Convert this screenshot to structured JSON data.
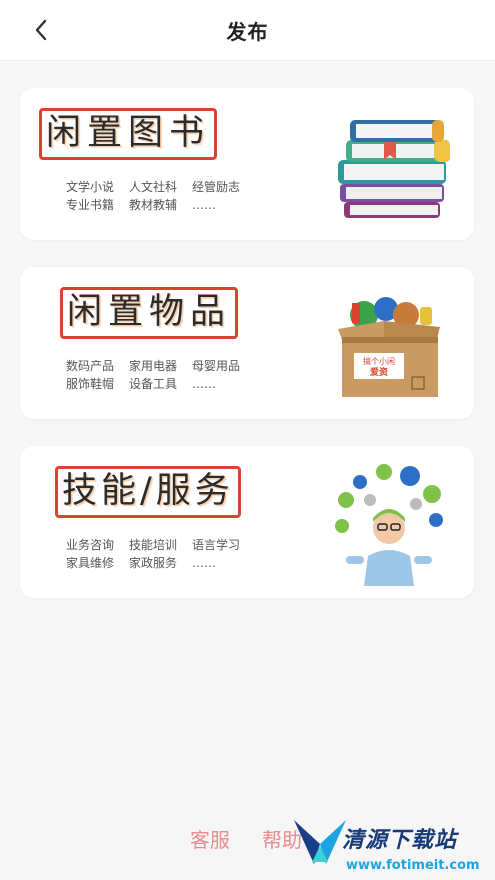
{
  "header": {
    "title": "发布"
  },
  "cards": [
    {
      "title": "闲置图书",
      "tags": [
        "文学小说",
        "人文社科",
        "经管励志",
        "专业书籍",
        "教材教辅",
        "……"
      ]
    },
    {
      "title": "闲置物品",
      "tags": [
        "数码产品",
        "家用电器",
        "母婴用品",
        "服饰鞋帽",
        "设备工具",
        "……"
      ]
    },
    {
      "title": "技能/服务",
      "tags": [
        "业务咨询",
        "技能培训",
        "语言学习",
        "家具维修",
        "家政服务",
        "……"
      ]
    }
  ],
  "box_label": [
    "搞个小闲",
    "爱资"
  ],
  "footer": {
    "service": "客服",
    "help": "帮助"
  },
  "watermark": {
    "text": "清源下载站",
    "url": "www.fotimeit.com"
  },
  "colors": {
    "highlight_border": "#d8432f",
    "footer_link": "#e88b8b"
  }
}
